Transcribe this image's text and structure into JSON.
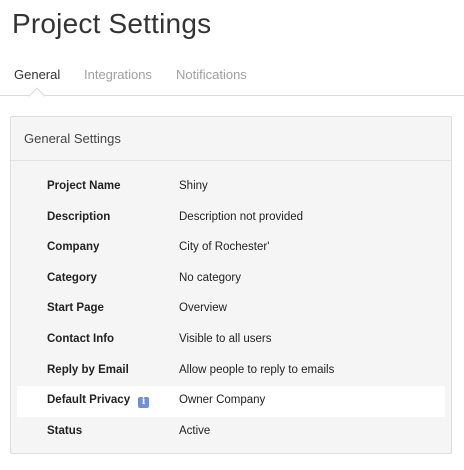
{
  "page": {
    "title": "Project Settings"
  },
  "tabs": [
    {
      "label": "General",
      "active": true
    },
    {
      "label": "Integrations",
      "active": false
    },
    {
      "label": "Notifications",
      "active": false
    }
  ],
  "panel": {
    "title": "General Settings",
    "rows": [
      {
        "label": "Project Name",
        "value": "Shiny"
      },
      {
        "label": "Description",
        "value": "Description not provided"
      },
      {
        "label": "Company",
        "value": "City of Rochester'"
      },
      {
        "label": "Category",
        "value": "No category"
      },
      {
        "label": "Start Page",
        "value": "Overview"
      },
      {
        "label": "Contact Info",
        "value": "Visible to all users"
      },
      {
        "label": "Reply by Email",
        "value": "Allow people to reply to emails"
      },
      {
        "label": "Default Privacy",
        "value": "Owner Company",
        "icon": "info-icon",
        "icon_glyph": "i"
      },
      {
        "label": "Status",
        "value": "Active"
      }
    ]
  }
}
